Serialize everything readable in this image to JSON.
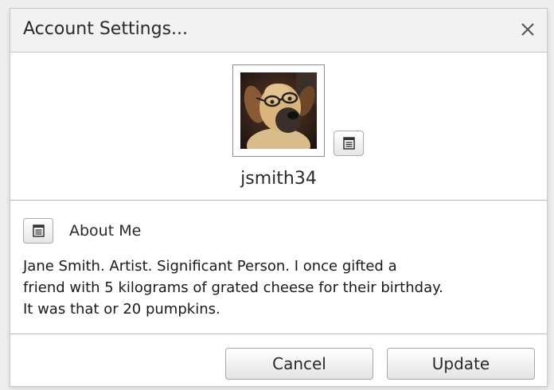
{
  "dialog": {
    "title": "Account Settings...",
    "close_icon": "close-icon"
  },
  "profile": {
    "avatar": "dog-with-glasses-photo",
    "edit_icon": "edit-document-icon",
    "username": "jsmith34"
  },
  "about": {
    "edit_icon": "edit-document-icon",
    "label": "About Me",
    "lines": [
      "Jane Smith.  Artist.  Significant Person.  I once gifted a",
      "friend with 5 kilograms of grated cheese for their birthday.",
      "It was that or 20 pumpkins."
    ]
  },
  "footer": {
    "cancel_label": "Cancel",
    "update_label": "Update"
  }
}
